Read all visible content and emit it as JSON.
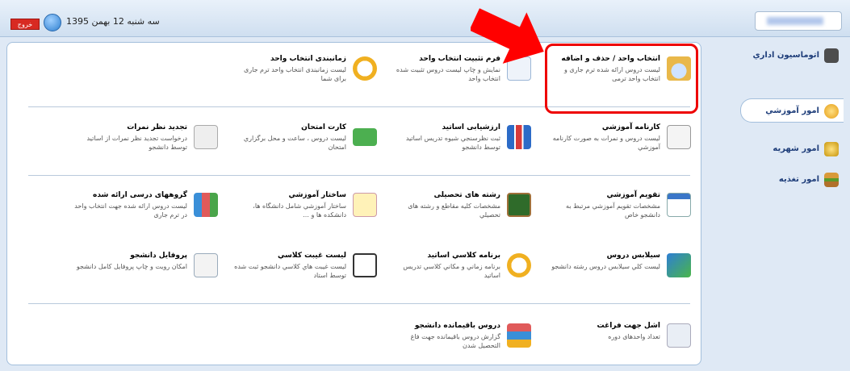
{
  "header": {
    "logout_label": "خروج",
    "date": "سه شنبه 12 بهمن 1395"
  },
  "sidebar": {
    "items": [
      {
        "label": "اتوماسیون اداري",
        "icon": "office-icon"
      },
      {
        "label": "امور آموزشي",
        "icon": "education-icon"
      },
      {
        "label": "امور شهريه",
        "icon": "tuition-icon"
      },
      {
        "label": "امور تغذيه",
        "icon": "food-icon"
      }
    ]
  },
  "cards": [
    {
      "title": "انتخاب واحد / حذف و اضافه",
      "desc": "لیست دروس ارائه شده ترم جاری و انتخاب واحد ترمی",
      "icon": "clock-book-icon"
    },
    {
      "title": "فرم تثبیت انتخاب واحد",
      "desc": "نمایش و چاپ لیست دروس تثبیت شده انتخاب واحد",
      "icon": "form-edit-icon"
    },
    {
      "title": "زمانبندی انتخاب واحد",
      "desc": "لیست زمانبندی انتخاب واحد ترم جاری برای شما",
      "icon": "clock-icon"
    },
    {
      "title": "کارنامه آموزشي",
      "desc": "لیست دروس و نمرات به صورت کارنامه آموزشي",
      "icon": "report-card-icon"
    },
    {
      "title": "ارزشیابی اساتید",
      "desc": "ثبت نظرسنجي شیوه تدریس اساتید توسط دانشجو",
      "icon": "bar-chart-icon"
    },
    {
      "title": "کارت امتحان",
      "desc": "لیست دروس ، ساعت و محل برگزاري امتحان",
      "icon": "exam-card-icon"
    },
    {
      "title": "تجدید نظر نمرات",
      "desc": "درخواست تجدید نظر نمرات از اساتید توسط دانشجو",
      "icon": "checkmark-icon"
    },
    {
      "title": "تقویم آموزشي",
      "desc": "مشخصات تقویم آموزشي مرتبط به دانشجو خاص",
      "icon": "calendar-icon"
    },
    {
      "title": "رشته های تحصیلی",
      "desc": "مشخصات کلیه مقاطع و رشته های تحصیلي",
      "icon": "blackboard-icon"
    },
    {
      "title": "ساختار آموزشي",
      "desc": "ساختار آموزشي شامل دانشگاه ها، دانشکده ها و ...",
      "icon": "structure-icon"
    },
    {
      "title": "گروههای درسی ارائه شده",
      "desc": "لیست دروس ارائه شده جهت انتخاب واحد در ترم جاری",
      "icon": "books-icon"
    },
    {
      "title": "سیلابس دروس",
      "desc": "لیست کلي سیلابس دروس رشته دانشجو",
      "icon": "book-icon"
    },
    {
      "title": "برنامه کلاسي اساتید",
      "desc": "برنامه زماني و مکاني کلاسي تدریس اساتید",
      "icon": "clock-icon"
    },
    {
      "title": "لیست غیبت کلاسي",
      "desc": "لیست غیبت هاي کلاسي دانشجو ثبت شده توسط استاد",
      "icon": "checklist-icon"
    },
    {
      "title": "پروفایل دانشجو",
      "desc": "امکان رویت و چاپ پروفایل کامل دانشجو",
      "icon": "profile-icon"
    },
    {
      "title": "اشل جهت فراغت",
      "desc": "تعداد واحدهای دوره",
      "icon": "certificate-icon"
    },
    {
      "title": "دروس باقیمانده دانشجو",
      "desc": "گزارش دروس باقیمانده جهت فاغ التحصیل شدن",
      "icon": "stacked-books-icon"
    }
  ]
}
